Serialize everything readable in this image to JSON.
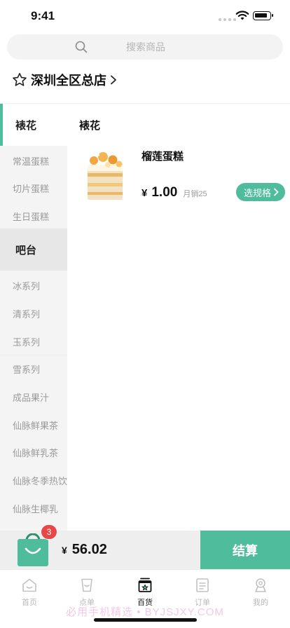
{
  "status_bar": {
    "time": "9:41"
  },
  "search": {
    "placeholder": "搜索商品"
  },
  "store": {
    "name": "深圳全区总店"
  },
  "sidebar": {
    "groups": [
      {
        "label": "裱花"
      },
      {
        "label": "吧台"
      }
    ],
    "items": [
      {
        "label": "常温蛋糕"
      },
      {
        "label": "切片蛋糕"
      },
      {
        "label": "生日蛋糕"
      },
      {
        "label": "冰系列"
      },
      {
        "label": "清系列"
      },
      {
        "label": "玉系列"
      },
      {
        "label": "雪系列"
      },
      {
        "label": "成品果汁"
      },
      {
        "label": "仙脉鲜果茶"
      },
      {
        "label": "仙脉鲜乳茶"
      },
      {
        "label": "仙脉冬季热饮"
      },
      {
        "label": "仙脉生椰乳"
      }
    ]
  },
  "main": {
    "section_title": "裱花",
    "products": [
      {
        "name": "榴莲蛋糕",
        "currency": "¥",
        "price": "1.00",
        "monthly_sales": "月销25",
        "spec_button": "选规格"
      }
    ]
  },
  "cart": {
    "badge_count": "3",
    "currency": "¥",
    "total": "56.02",
    "checkout_label": "结算"
  },
  "tabs": [
    {
      "label": "首页",
      "icon": "home-icon"
    },
    {
      "label": "点单",
      "icon": "cup-icon"
    },
    {
      "label": "百货",
      "icon": "store-icon",
      "active": true
    },
    {
      "label": "订单",
      "icon": "order-icon"
    },
    {
      "label": "我的",
      "icon": "profile-icon"
    }
  ],
  "watermark": "必用手机精选 • BYJSJXY.COM",
  "colors": {
    "accent": "#4fbd9c",
    "badge": "#e94747"
  }
}
